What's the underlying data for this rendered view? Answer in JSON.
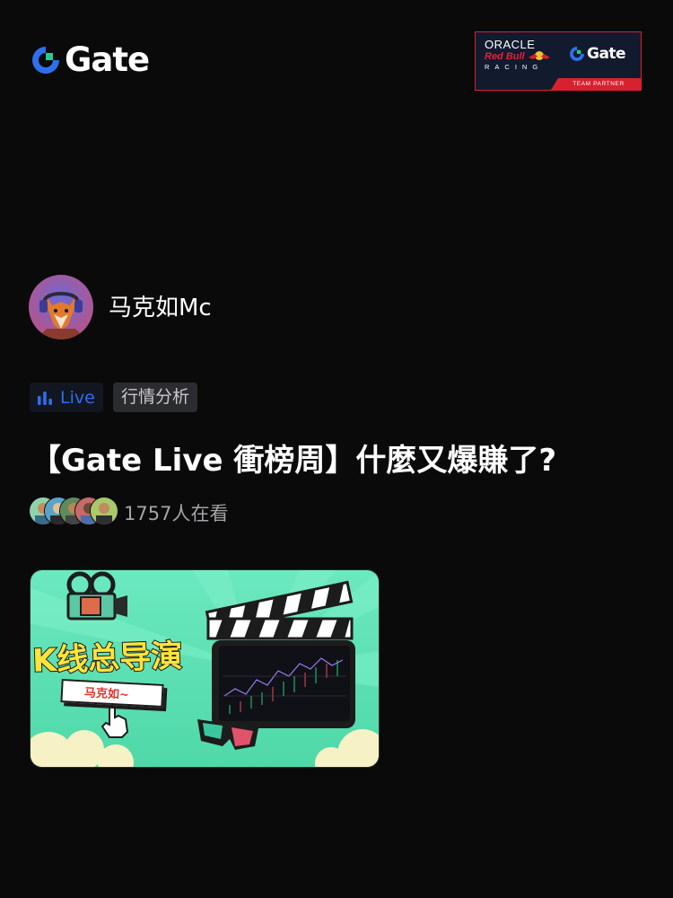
{
  "header": {
    "logo_text": "Gate",
    "partner_badge": {
      "oracle": "ORACLE",
      "redbull": "Red Bull",
      "racing": "RACING",
      "gate": "Gate",
      "ribbon": "TEAM PARTNER"
    }
  },
  "host": {
    "name": "马克如Mc"
  },
  "tags": {
    "live": "Live",
    "category": "行情分析"
  },
  "stream": {
    "title": "【Gate Live 衝榜周】什麼又爆賺了?",
    "viewers": "1757人在看"
  },
  "thumbnail": {
    "headline": "K线总导演",
    "name_tag": "马克如~"
  },
  "colors": {
    "background": "#0a0a0b",
    "accent_blue": "#2f6fea",
    "thumbnail_green": "#5ee3b4",
    "thumbnail_yellow": "#ffe43a",
    "partner_red": "#d8212f"
  }
}
